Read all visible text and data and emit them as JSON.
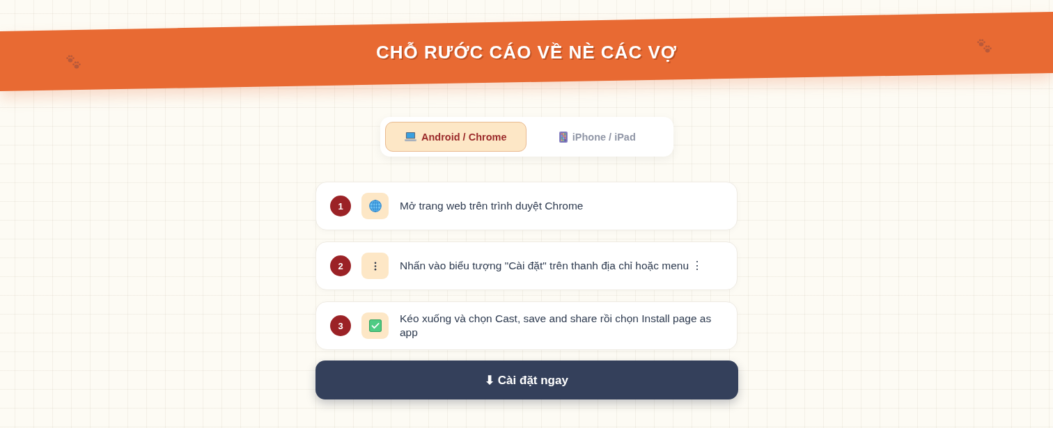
{
  "banner": {
    "title": "CHỖ RƯỚC CÁO VỀ NÈ CÁC VỢ"
  },
  "tabs": [
    {
      "label": "Android / Chrome",
      "kind": "laptop",
      "selected": true
    },
    {
      "label": "iPhone / iPad",
      "kind": "tablet",
      "selected": false
    }
  ],
  "steps": [
    {
      "number": "1",
      "kind": "globe",
      "text": "Mở trang web trên trình duyệt Chrome"
    },
    {
      "number": "2",
      "kind": "dots",
      "text": "Nhấn vào biểu tượng \"Cài đặt\" trên thanh địa chỉ hoặc menu ⋮"
    },
    {
      "number": "3",
      "kind": "check",
      "text": "Kéo xuống và chọn Cast, save and share rồi chọn Install page as app"
    }
  ],
  "install_button": {
    "label": "⬇ Cài đặt ngay"
  }
}
